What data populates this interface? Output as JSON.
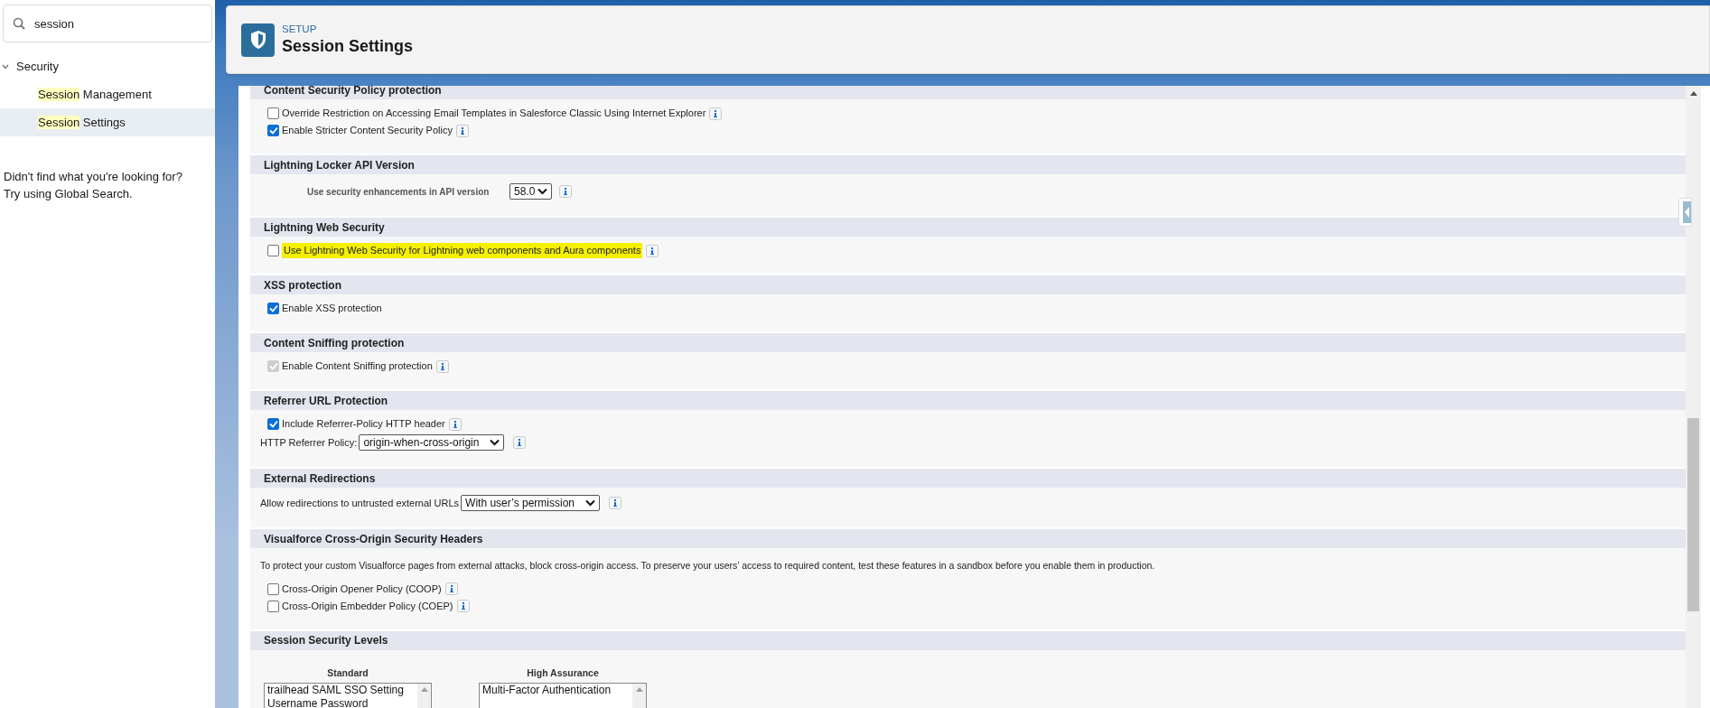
{
  "sidebar": {
    "search": {
      "value": "session"
    },
    "tree": [
      {
        "label": "Security",
        "expanded": true,
        "children": [
          {
            "match": "Session",
            "rest": " Management",
            "selected": false
          },
          {
            "match": "Session",
            "rest": " Settings",
            "selected": true
          }
        ]
      }
    ],
    "help": [
      "Didn't find what you're looking for?",
      "Try using Global Search."
    ]
  },
  "header": {
    "eyebrow": "SETUP",
    "title": "Session Settings"
  },
  "sections": [
    {
      "title": "Content Security Policy protection",
      "rows": [
        {
          "kind": "checkbox",
          "label": "Override Restriction on Accessing Email Templates in Salesforce Classic Using Internet Explorer",
          "checked": false,
          "disabled": false,
          "highlighted": false,
          "info": true
        },
        {
          "kind": "checkbox",
          "label": "Enable Stricter Content Security Policy",
          "checked": true,
          "disabled": false,
          "highlighted": false,
          "info": true
        }
      ]
    },
    {
      "title": "Lightning Locker API Version",
      "rows": [
        {
          "kind": "api-select",
          "label": "Use security enhancements in API version",
          "value": "58.0",
          "info": true
        }
      ]
    },
    {
      "title": "Lightning Web Security",
      "rows": [
        {
          "kind": "checkbox",
          "label": "Use Lightning Web Security for Lightning web components and Aura components",
          "checked": false,
          "disabled": false,
          "highlighted": true,
          "info": true
        }
      ]
    },
    {
      "title": "XSS protection",
      "rows": [
        {
          "kind": "checkbox",
          "label": "Enable XSS protection",
          "checked": true,
          "disabled": false,
          "highlighted": false,
          "info": false
        }
      ]
    },
    {
      "title": "Content Sniffing protection",
      "rows": [
        {
          "kind": "checkbox",
          "label": "Enable Content Sniffing protection",
          "checked": true,
          "disabled": true,
          "highlighted": false,
          "info": true
        }
      ]
    },
    {
      "title": "Referrer URL Protection",
      "rows": [
        {
          "kind": "checkbox",
          "label": "Include Referrer-Policy HTTP header",
          "checked": true,
          "disabled": false,
          "highlighted": false,
          "info": true
        },
        {
          "kind": "select",
          "label": "HTTP Referrer Policy:",
          "value": "origin-when-cross-origin",
          "info": true
        }
      ]
    },
    {
      "title": "External Redirections",
      "rows": [
        {
          "kind": "select",
          "label": "Allow redirections to untrusted external URLs",
          "value": "With user’s permission",
          "info": true
        }
      ]
    },
    {
      "title": "Visualforce Cross-Origin Security Headers",
      "rows": [
        {
          "kind": "text",
          "text": "To protect your custom Visualforce pages from external attacks, block cross-origin access. To preserve your users’ access to required content, test these features in a sandbox before you enable them in production."
        },
        {
          "kind": "checkbox",
          "label": "Cross-Origin Opener Policy (COOP)",
          "checked": false,
          "disabled": false,
          "highlighted": false,
          "info": true
        },
        {
          "kind": "checkbox",
          "label": "Cross-Origin Embedder Policy (COEP)",
          "checked": false,
          "disabled": false,
          "highlighted": false,
          "info": true
        }
      ]
    },
    {
      "title": "Session Security Levels",
      "rows": [
        {
          "kind": "levels",
          "columns": [
            {
              "title": "Standard",
              "items": [
                "trailhead SAML SSO Setting",
                "Username Password"
              ]
            },
            {
              "title": "High Assurance",
              "items": [
                "Multi-Factor Authentication"
              ]
            }
          ]
        }
      ]
    }
  ]
}
